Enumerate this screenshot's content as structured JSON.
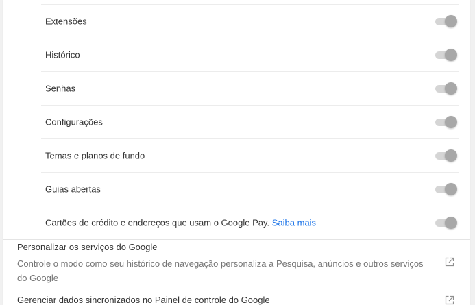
{
  "sync_items": [
    {
      "label": "Extensões",
      "enabled": true
    },
    {
      "label": "Histórico",
      "enabled": true
    },
    {
      "label": "Senhas",
      "enabled": true
    },
    {
      "label": "Configurações",
      "enabled": true
    },
    {
      "label": "Temas e planos de fundo",
      "enabled": true
    },
    {
      "label": "Guias abertas",
      "enabled": true
    },
    {
      "label": "Cartões de crédito e endereços que usam o Google Pay.",
      "link": "Saiba mais",
      "enabled": true
    }
  ],
  "personalize": {
    "title": "Personalizar os serviços do Google",
    "description": "Controle o modo como seu histórico de navegação personaliza a Pesquisa, anúncios e outros serviços do Google"
  },
  "manage": {
    "title": "Gerenciar dados sincronizados no Painel de controle do Google"
  },
  "colors": {
    "link": "#1a73e8",
    "toggle_track": "#d5d5d5",
    "toggle_knob": "#a8a8a8",
    "secondary_text": "#757575"
  },
  "icons": {
    "external_link": "open-in-new-icon"
  }
}
